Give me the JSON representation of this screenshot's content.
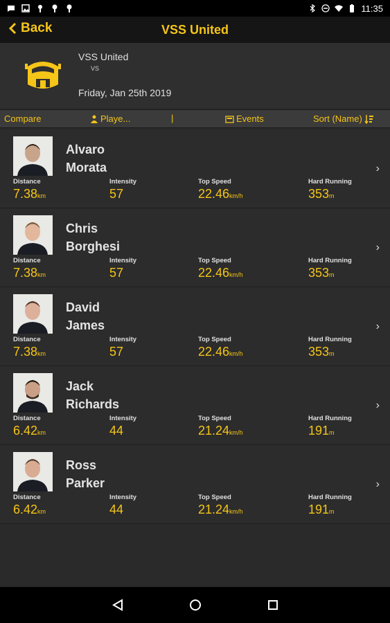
{
  "status": {
    "time": "11:35"
  },
  "appbar": {
    "back_label": "Back",
    "title": "VSS United"
  },
  "match": {
    "team": "VSS United",
    "vs": "VS",
    "date": "Friday, Jan 25th 2019"
  },
  "filters": {
    "compare": "Compare",
    "players": "Playe...",
    "divider": "|",
    "events": "Events",
    "sort": "Sort (Name)"
  },
  "stat_labels": {
    "distance": "Distance",
    "intensity": "Intensity",
    "top_speed": "Top Speed",
    "hard_running": "Hard Running"
  },
  "units": {
    "distance": "km",
    "top_speed": "km/h",
    "hard_running": "m"
  },
  "players": [
    {
      "first": "Alvaro",
      "last": "Morata",
      "distance": "7.38",
      "intensity": "57",
      "top_speed": "22.46",
      "hard_running": "353"
    },
    {
      "first": "Chris",
      "last": "Borghesi",
      "distance": "7.38",
      "intensity": "57",
      "top_speed": "22.46",
      "hard_running": "353"
    },
    {
      "first": "David",
      "last": "James",
      "distance": "7.38",
      "intensity": "57",
      "top_speed": "22.46",
      "hard_running": "353"
    },
    {
      "first": "Jack",
      "last": "Richards",
      "distance": "6.42",
      "intensity": "44",
      "top_speed": "21.24",
      "hard_running": "191"
    },
    {
      "first": "Ross",
      "last": "Parker",
      "distance": "6.42",
      "intensity": "44",
      "top_speed": "21.24",
      "hard_running": "191"
    }
  ],
  "colors": {
    "accent": "#f5c518",
    "background": "#2a2a2a",
    "bar": "#151515"
  }
}
